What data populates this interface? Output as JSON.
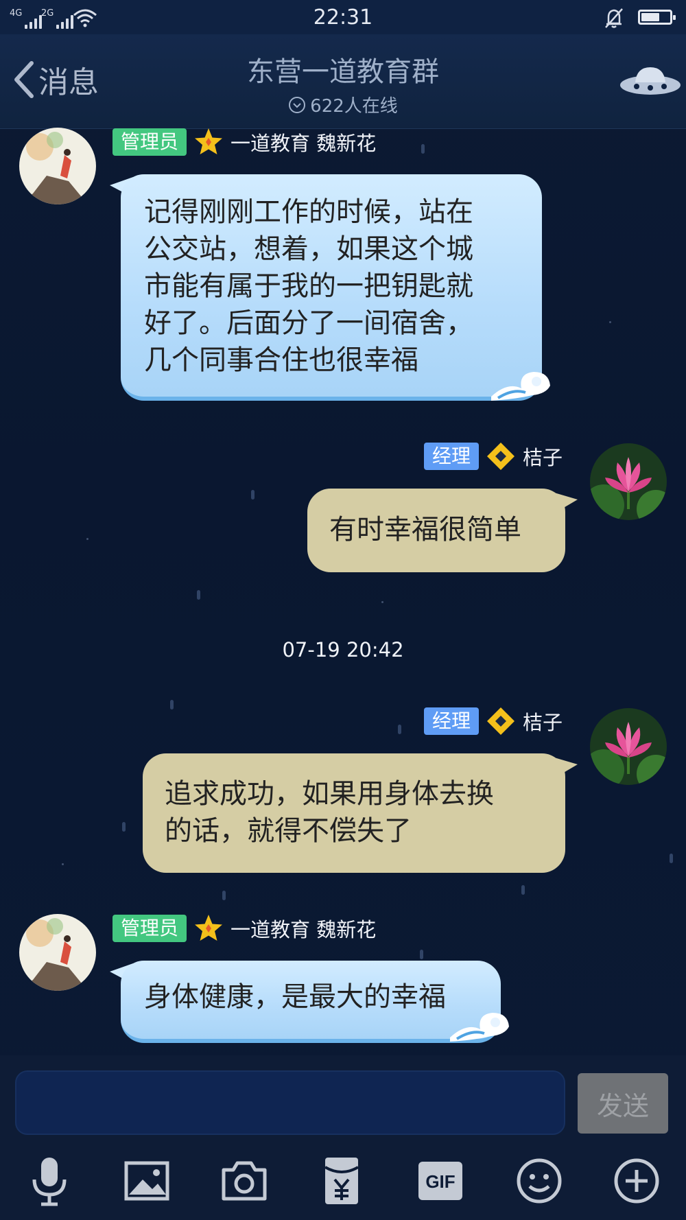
{
  "status_bar": {
    "network_1": "4G",
    "network_2": "2G",
    "time": "22:31",
    "icons": [
      "signal-icon",
      "wifi-icon",
      "bell-muted-icon",
      "battery-icon"
    ]
  },
  "header": {
    "back_label": "消息",
    "title": "东营一道教育群",
    "online": "622人在线",
    "icons": [
      "chevron-left-icon",
      "online-check-icon",
      "ufo-icon"
    ]
  },
  "messages": [
    {
      "side": "left",
      "badge": "管理员",
      "name": "一道教育 魏新花",
      "bubble_style": "blue",
      "lines": [
        "记得刚刚工作的时候，站在",
        "公交站，想着，如果这个城",
        "市能有属于我的一把钥匙就",
        "好了。后面分了一间宿舍，",
        "几个同事合住也很幸福"
      ]
    },
    {
      "side": "right",
      "badge": "经理",
      "name": "桔子",
      "bubble_style": "tan",
      "lines": [
        "有时幸福很简单"
      ]
    },
    {
      "side": "right",
      "badge": "经理",
      "name": "桔子",
      "bubble_style": "tan",
      "lines": [
        "追求成功，如果用身体去换",
        "的话，就得不偿失了"
      ]
    },
    {
      "side": "left",
      "badge": "管理员",
      "name": "一道教育 魏新花",
      "bubble_style": "blue",
      "lines": [
        "身体健康，是最大的幸福"
      ]
    }
  ],
  "timestamp": "07-19 20:42",
  "input": {
    "placeholder": "",
    "send_label": "发送"
  },
  "toolbar": {
    "icons": [
      "microphone-icon",
      "image-icon",
      "camera-icon",
      "red-packet-icon",
      "gif-icon",
      "emoji-icon",
      "plus-icon"
    ],
    "gif_label": "GIF"
  },
  "colors": {
    "background": "#0b1830",
    "admin_badge": "#43c780",
    "manager_badge": "#5f9cf5",
    "blue_bubble": "#b6dcfb",
    "tan_bubble": "#d5cda4"
  }
}
